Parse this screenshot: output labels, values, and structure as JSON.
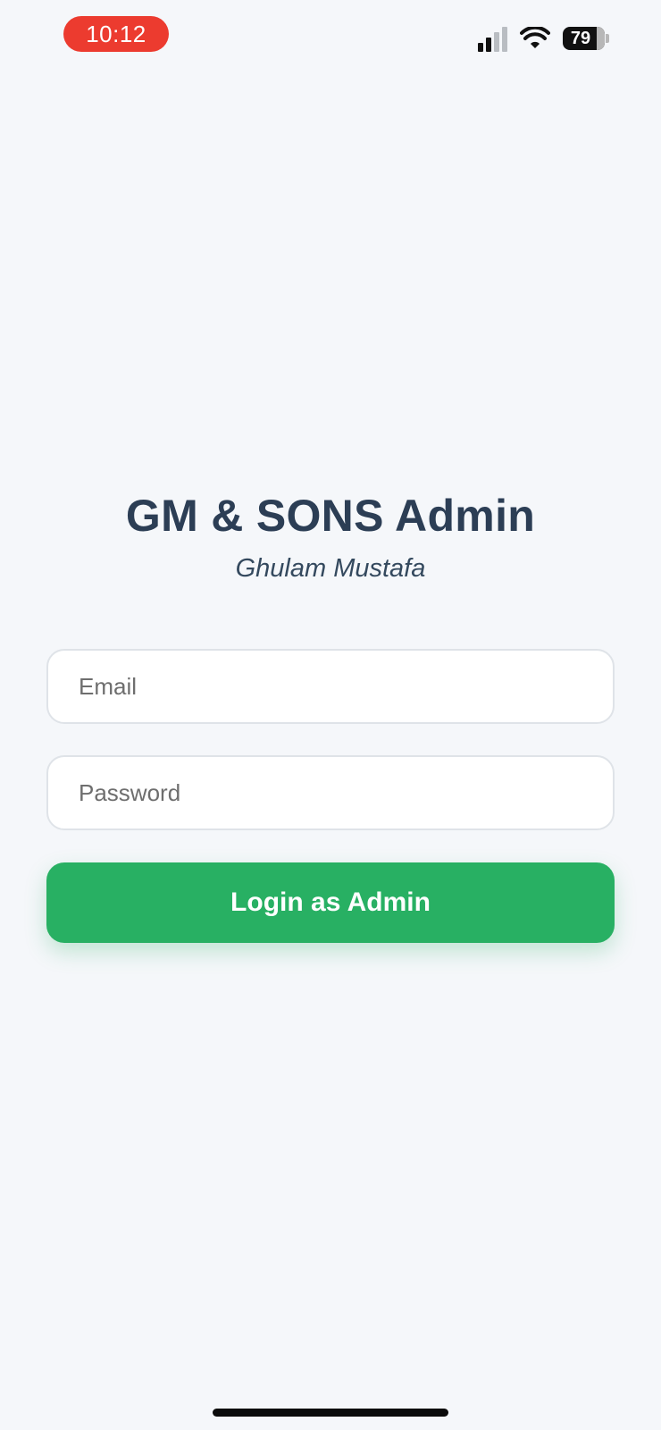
{
  "status_bar": {
    "time": "10:12",
    "battery_level": "79",
    "icons": [
      "signal-icon",
      "wifi-icon",
      "battery-icon"
    ]
  },
  "header": {
    "title": "GM & SONS Admin",
    "subtitle": "Ghulam Mustafa"
  },
  "form": {
    "email": {
      "placeholder": "Email",
      "value": ""
    },
    "password": {
      "placeholder": "Password",
      "value": ""
    },
    "login_label": "Login as Admin"
  },
  "colors": {
    "background": "#f5f7fa",
    "title": "#2c3e55",
    "button": "#28b063",
    "time_pill": "#ec3b2f"
  }
}
